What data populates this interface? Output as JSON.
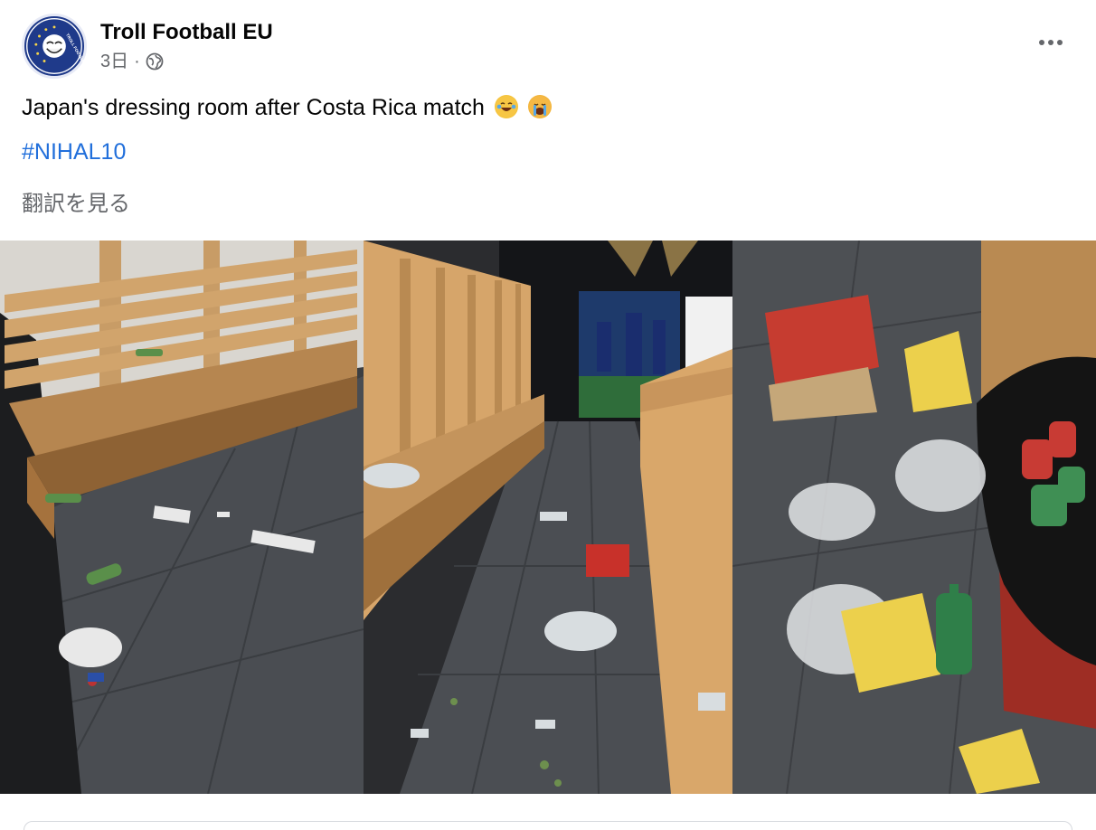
{
  "post": {
    "author": "Troll Football EU",
    "time": "3日",
    "separator": "·",
    "privacy_icon": "globe-icon",
    "menu_icon": "more-horizontal-icon",
    "text": "Japan's dressing room after Costa Rica match",
    "emojis": [
      "laughing-crying-emoji",
      "loudly-crying-emoji"
    ],
    "hashtag": "#NIHAL10",
    "translate_label": "翻訳を見る"
  },
  "avatar": {
    "logo_text": "TROLL FOOTBALL EU",
    "brand_color": "#1f3a8a"
  },
  "colors": {
    "hashtag": "#216fdb",
    "secondary_text": "#65676b",
    "primary_text": "#050505"
  },
  "media": {
    "panels": [
      "locker-room-benches-photo",
      "locker-room-corridor-photo",
      "trash-bag-closeup-photo"
    ]
  }
}
